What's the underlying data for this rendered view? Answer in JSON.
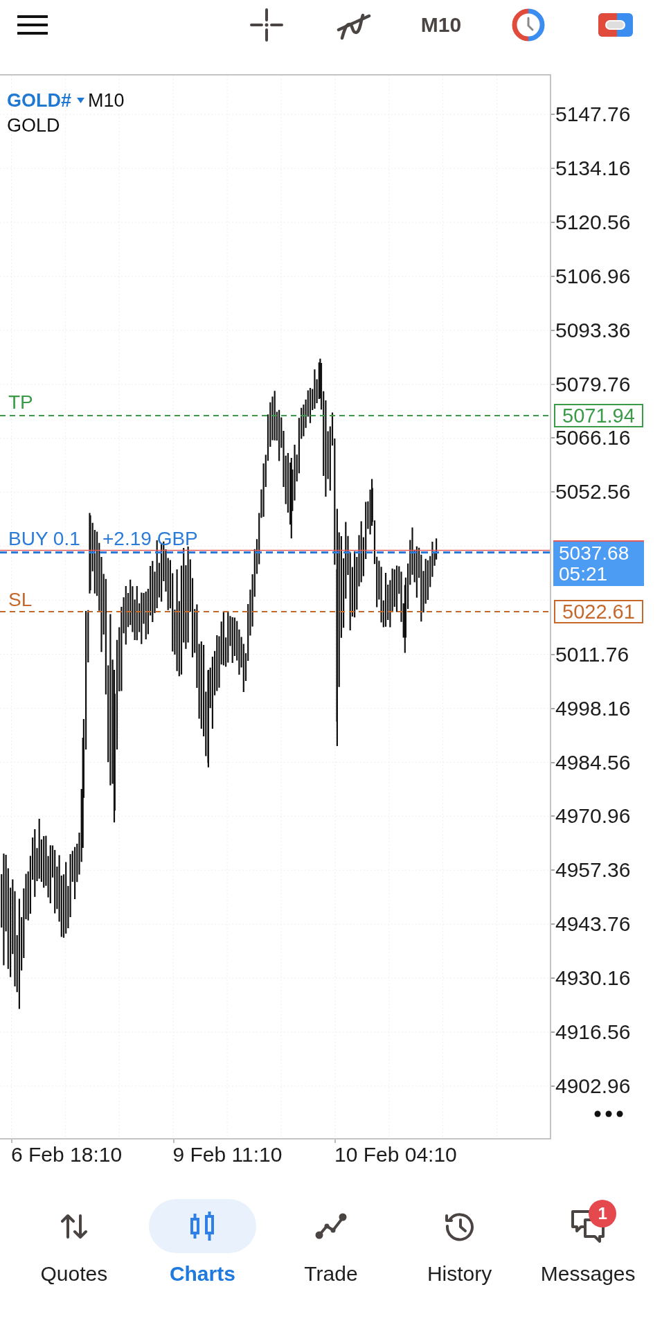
{
  "toolbar": {
    "timeframe": "M10"
  },
  "chart": {
    "symbol": "GOLD#",
    "period": "M10",
    "description": "GOLD",
    "trade_levels": [
      {
        "kind": "take_profit",
        "label": "TP",
        "price": "5071.94",
        "color": "#3a9a47"
      },
      {
        "kind": "position",
        "label": "BUY 0.1",
        "profit": "+2.19 GBP",
        "color": "#2b7bd9"
      },
      {
        "kind": "stop_loss",
        "label": "SL",
        "price": "5022.61",
        "color": "#c4682c"
      }
    ],
    "current_price": {
      "price": "5037.68",
      "countdown": "05:21"
    },
    "price_axis": {
      "upper": [
        "5147.76",
        "5134.16",
        "5120.56",
        "5106.96",
        "5093.36",
        "5079.76",
        "5066.16",
        "5052.56"
      ],
      "lower": [
        "5011.76",
        "4998.16",
        "4984.56",
        "4970.96",
        "4957.36",
        "4943.76",
        "4930.16",
        "4916.56",
        "4902.96"
      ]
    },
    "time_axis": [
      "6 Feb 18:10",
      "9 Feb 11:10",
      "10 Feb 04:10"
    ]
  },
  "nav": [
    {
      "label": "Quotes",
      "selected": false
    },
    {
      "label": "Charts",
      "selected": true
    },
    {
      "label": "Trade",
      "selected": false
    },
    {
      "label": "History",
      "selected": false
    },
    {
      "label": "Messages",
      "selected": false,
      "badge": "1"
    }
  ]
}
